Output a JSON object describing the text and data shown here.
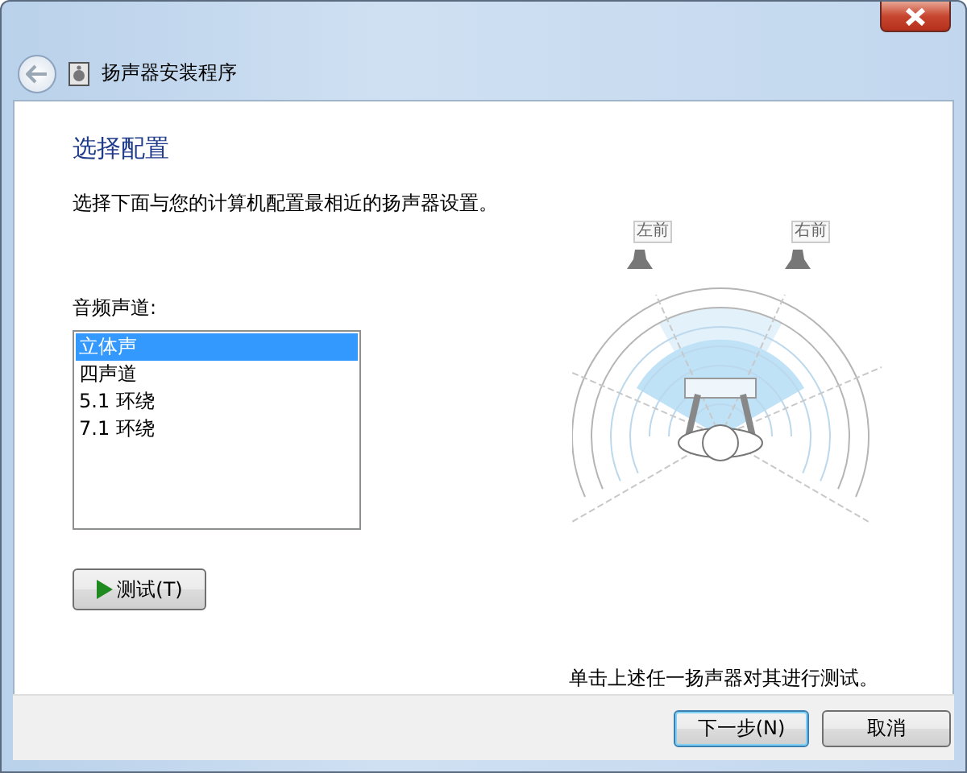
{
  "window": {
    "title": "扬声器安装程序"
  },
  "heading": "选择配置",
  "description": "选择下面与您的计算机配置最相近的扬声器设置。",
  "channels_label": "音频声道:",
  "channels": [
    {
      "label": "立体声",
      "selected": true
    },
    {
      "label": "四声道",
      "selected": false
    },
    {
      "label": "5.1 环绕",
      "selected": false
    },
    {
      "label": "7.1 环绕",
      "selected": false
    }
  ],
  "test_button": "测试(T)",
  "speakers": [
    {
      "label": "左前"
    },
    {
      "label": "右前"
    }
  ],
  "hint": "单击上述任一扬声器对其进行测试。",
  "buttons": [
    {
      "label": "下一步(N)",
      "kind": "default"
    },
    {
      "label": "取消",
      "kind": "normal"
    }
  ]
}
